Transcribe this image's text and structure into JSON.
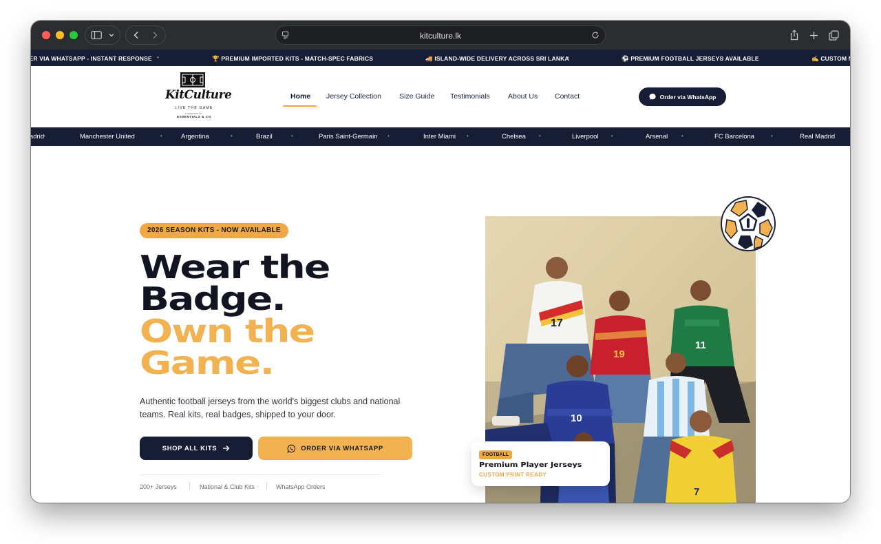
{
  "browser": {
    "url": "kitculture.lk"
  },
  "announcements": [
    "ORDER VIA WHATSAPP - INSTANT RESPONSE",
    "🏆 PREMIUM IMPORTED KITS - MATCH-SPEC FABRICS",
    "🚚 ISLAND-WIDE DELIVERY ACROSS SRI LANKA",
    "⚽ PREMIUM FOOTBALL JERSEYS AVAILABLE",
    "✍ CUSTOM NAME"
  ],
  "logo": {
    "name": "KitCulture",
    "tagline": "LIVE THE GAME",
    "powered_by": "POWERED BY",
    "company": "ESSENTIALS & CO"
  },
  "nav": {
    "items": [
      "Home",
      "Jersey Collection",
      "Size Guide",
      "Testimonials",
      "About Us",
      "Contact"
    ],
    "active": "Home",
    "cta": "Order via WhatsApp"
  },
  "teams": [
    "Madrid",
    "Manchester United",
    "Argentina",
    "Brazil",
    "Paris Saint-Germain",
    "Inter Miami",
    "Chelsea",
    "Liverpool",
    "Arsenal",
    "FC Barcelona",
    "Real Madrid"
  ],
  "hero": {
    "badge": "2026 SEASON KITS - NOW AVAILABLE",
    "headline_dark_1": "Wear the",
    "headline_dark_2": "Badge.",
    "headline_gold_1": "Own the",
    "headline_gold_2": "Game.",
    "description": "Authentic football jerseys from the world's biggest clubs and national teams. Real kits, real badges, shipped to your door.",
    "primary_cta": "SHOP ALL KITS",
    "secondary_cta": "ORDER VIA WHATSAPP",
    "stats": [
      "200+ Jerseys",
      "National & Club Kits",
      "WhatsApp Orders"
    ]
  },
  "feature_card": {
    "tag": "FOOTBALL",
    "title": "Premium Player Jerseys",
    "subtitle": "CUSTOM PRINT READY"
  },
  "photo_numbers": [
    "17",
    "19",
    "11",
    "10",
    "7"
  ],
  "colors": {
    "navy": "#161d35",
    "gold": "#f2b251",
    "text": "#121521"
  }
}
